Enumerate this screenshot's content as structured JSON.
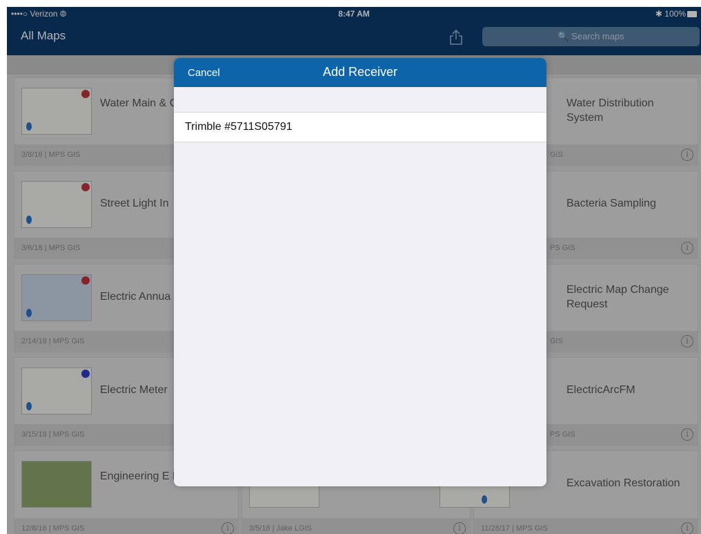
{
  "status_bar": {
    "carrier": "••••○ Verizon ⦾",
    "time": "8:47 AM",
    "battery": "✱ 100%"
  },
  "nav": {
    "title": "All Maps",
    "search_placeholder": "🔍 Search maps"
  },
  "cards": [
    {
      "name": "Water Main & Cards",
      "footer": "3/8/18 | MPS GIS",
      "badge": "red"
    },
    {
      "name": "Water Distribution System",
      "footer": "GIS",
      "badge": "red"
    },
    {
      "name": "Street Light In",
      "footer": "3/6/18 | MPS GIS",
      "badge": "red"
    },
    {
      "name": "Bacteria Sampling",
      "footer": "PS GIS",
      "badge": "red"
    },
    {
      "name": "Electric Annua",
      "footer": "2/14/18 | MPS GIS",
      "badge": "red"
    },
    {
      "name": "Electric Map Change Request",
      "footer": "GIS",
      "badge": "red"
    },
    {
      "name": "Electric Meter",
      "footer": "3/15/18 | MPS GIS",
      "badge": "blue"
    },
    {
      "name": "ElectricArcFM",
      "footer": "PS GIS",
      "badge": "blue"
    },
    {
      "name": "Engineering E Permits",
      "footer": "12/8/16 | MPS GIS",
      "badge": "red"
    },
    {
      "name": "",
      "footer": "3/5/18 | Jake LGIS",
      "badge": "red"
    },
    {
      "name": "Excavation Restoration",
      "footer": "11/28/17 | MPS GIS",
      "badge": "red"
    }
  ],
  "modal": {
    "cancel_label": "Cancel",
    "title": "Add Receiver",
    "receivers": [
      "Trimble #5711S05791"
    ]
  },
  "colors": {
    "nav_bar": "#0c3c6e",
    "modal_header": "#0e64a8"
  }
}
